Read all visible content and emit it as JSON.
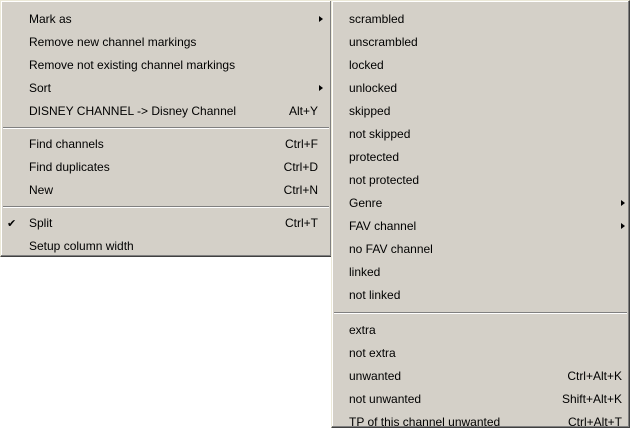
{
  "main_menu": {
    "items": [
      {
        "label": "Mark as",
        "shortcut": "",
        "submenu": true
      },
      {
        "label": "Remove new channel markings",
        "shortcut": ""
      },
      {
        "label": "Remove not existing channel markings",
        "shortcut": ""
      },
      {
        "label": "Sort",
        "shortcut": "",
        "submenu": true
      },
      {
        "label": "DISNEY CHANNEL -> Disney Channel",
        "shortcut": "Alt+Y"
      },
      {
        "label": "Find channels",
        "shortcut": "Ctrl+F"
      },
      {
        "label": "Find duplicates",
        "shortcut": "Ctrl+D"
      },
      {
        "label": "New",
        "shortcut": "Ctrl+N"
      },
      {
        "label": "Split",
        "shortcut": "Ctrl+T",
        "checked": true,
        "check_glyph": "✔"
      },
      {
        "label": "Setup column width",
        "shortcut": ""
      }
    ]
  },
  "sub_menu": {
    "items": [
      {
        "label": "scrambled",
        "shortcut": ""
      },
      {
        "label": "unscrambled",
        "shortcut": ""
      },
      {
        "label": "locked",
        "shortcut": ""
      },
      {
        "label": "unlocked",
        "shortcut": ""
      },
      {
        "label": "skipped",
        "shortcut": ""
      },
      {
        "label": "not skipped",
        "shortcut": ""
      },
      {
        "label": "protected",
        "shortcut": ""
      },
      {
        "label": "not protected",
        "shortcut": ""
      },
      {
        "label": "Genre",
        "shortcut": "",
        "submenu": true
      },
      {
        "label": "FAV channel",
        "shortcut": "",
        "submenu": true
      },
      {
        "label": "no FAV channel",
        "shortcut": ""
      },
      {
        "label": "linked",
        "shortcut": ""
      },
      {
        "label": "not linked",
        "shortcut": ""
      },
      {
        "label": "extra",
        "shortcut": ""
      },
      {
        "label": "not extra",
        "shortcut": ""
      },
      {
        "label": "unwanted",
        "shortcut": "Ctrl+Alt+K"
      },
      {
        "label": "not unwanted",
        "shortcut": "Shift+Alt+K"
      },
      {
        "label": "TP of this channel unwanted",
        "shortcut": "Ctrl+Alt+T"
      }
    ]
  },
  "colors": {
    "menu_bg": "#d4d0c8",
    "text": "#000000",
    "separator_dark": "#808080",
    "separator_light": "#ffffff"
  }
}
